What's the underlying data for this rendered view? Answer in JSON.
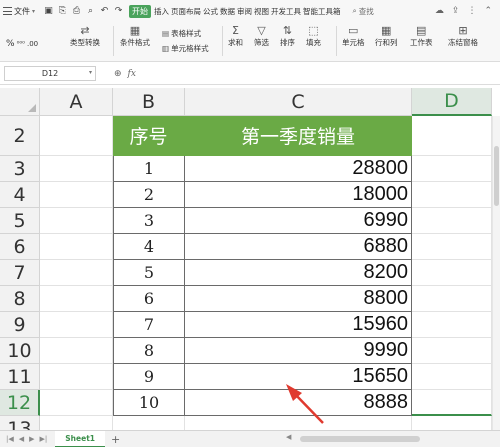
{
  "menubar": {
    "file_label": "文件",
    "active_tab": "开始",
    "tabs": [
      "插入",
      "页面布局",
      "公式",
      "数据",
      "审阅",
      "视图",
      "开发工具",
      "智能工具箱"
    ],
    "search_placeholder": "查找"
  },
  "toolbar": {
    "percent": "%",
    "decimal_inc": "⁰⁰⁰",
    "decimal_dec": ".00",
    "type_convert": "类型转换",
    "conditional_format": "条件格式",
    "table_style": "表格样式",
    "cell_style": "单元格样式",
    "sum": "求和",
    "filter": "筛选",
    "sort": "排序",
    "fill": "填充",
    "cell": "单元格",
    "row_col": "行和列",
    "worksheet": "工作表",
    "freeze": "冻结窗格"
  },
  "formula_bar": {
    "cell_ref": "D12",
    "fx": "fx",
    "content": ""
  },
  "columns": [
    "A",
    "B",
    "C",
    "D"
  ],
  "selected_column": "D",
  "rows": [
    "2",
    "3",
    "4",
    "5",
    "6",
    "7",
    "8",
    "9",
    "10",
    "11",
    "12",
    "13"
  ],
  "selected_row": "12",
  "table": {
    "header": [
      "序号",
      "第一季度销量"
    ],
    "rows": [
      [
        "1",
        "28800"
      ],
      [
        "2",
        "18000"
      ],
      [
        "3",
        "6990"
      ],
      [
        "4",
        "6880"
      ],
      [
        "5",
        "8200"
      ],
      [
        "6",
        "8800"
      ],
      [
        "7",
        "15960"
      ],
      [
        "8",
        "9990"
      ],
      [
        "9",
        "15650"
      ],
      [
        "10",
        "8888"
      ]
    ]
  },
  "sheets": {
    "active": "Sheet1",
    "add": "+"
  },
  "colors": {
    "header_fill": "#6aaa45",
    "accent": "#3b8f4b",
    "arrow": "#e03a2f"
  }
}
